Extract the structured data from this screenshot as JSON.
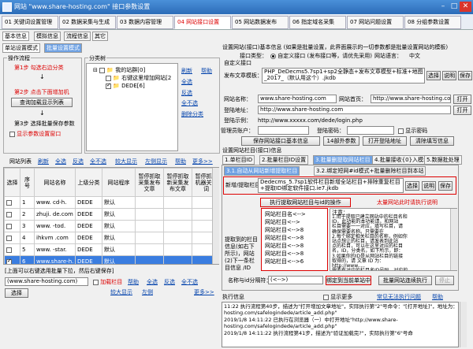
{
  "window": {
    "title": "网站 \"www.share-hosting.com\" 接口参数设置",
    "min": "–",
    "max": "□",
    "close": "✕"
  },
  "main_tabs": [
    {
      "label": "01 关键词设置管理"
    },
    {
      "label": "02 数据采集与生成"
    },
    {
      "label": "03 数据内容管理"
    },
    {
      "label": "04 网站接口设置"
    },
    {
      "label": "05 网站数据发布"
    },
    {
      "label": "06 指定域名采集"
    },
    {
      "label": "07 网站问题设置"
    },
    {
      "label": "08 分组参数设置"
    }
  ],
  "left_tabs": [
    "基本信息",
    "模拟信息",
    "流程信息",
    "其它"
  ],
  "mode_tabs": [
    "单站设置模式",
    "批量设置模式"
  ],
  "flow": {
    "group_title": "操作流程",
    "step1": "第1步 勾选右边分类",
    "step2": "第2步 点击下面增加机",
    "btn_query": "查询加载显示列表",
    "step3": "第3步 选择批量保存参数",
    "show_window": "显示参数设置窗口"
  },
  "category": {
    "title": "分类树",
    "root": "我的站群[0]",
    "child1": "右键这里增加网站[2",
    "child2": "DEDE[6]",
    "links": [
      "刷新",
      "帮助",
      "全选",
      "反选",
      "全不选",
      "删除分类"
    ]
  },
  "list": {
    "toolbar_label": "网站列表",
    "links": [
      "刷新",
      "全选",
      "反选",
      "全不选",
      "较大显示",
      "左侧显示",
      "帮助",
      "更多>>"
    ],
    "headers": [
      "选择",
      "序号",
      "网站名称",
      "上级分类",
      "网站程序",
      "暂停抓取采集发布文章",
      "暂停抓取新采集发布文章",
      "暂停抓取机器关键词"
    ],
    "rows": [
      {
        "no": "1",
        "name": "www.   cd-h.",
        "cat": "DEDE",
        "prog": "默认",
        "checked": false
      },
      {
        "no": "2",
        "name": "zhuji.  de.com",
        "cat": "DEDE",
        "prog": "默认",
        "checked": false
      },
      {
        "no": "3",
        "name": "www.   -tod.",
        "cat": "DEDE",
        "prog": "默认",
        "checked": false
      },
      {
        "no": "4",
        "name": "ihkvm   .com",
        "cat": "DEDE",
        "prog": "默认",
        "checked": false
      },
      {
        "no": "5",
        "name": "www.  -star.",
        "cat": "DEDE",
        "prog": "默认",
        "checked": false
      },
      {
        "no": "6",
        "name": "www.share-h.",
        "cat": "DEDE",
        "prog": "默认",
        "checked": true
      }
    ],
    "status": "[上面可以右键选用批量下拉，然后右键保存]",
    "site": "(www.share-hosting.com)",
    "add_cat": "加载栏目",
    "bottom_links": [
      "帮助",
      "全选",
      "反选",
      "全不选",
      "较大显示",
      "左侧",
      "更多>>"
    ],
    "select_btn": "选择"
  },
  "iface": {
    "title": "设置网站(接口)基本信息 (如果是批量设置，此界面展示的一切参数都是批量设置网站的模板)",
    "type_label": "接口类型：",
    "type_opt1": "自定义接口 (发布接口等，请优先采用)",
    "type_name_label": "网站语言：",
    "type_name_val": "中文",
    "custom_label": "自定义接口",
    "pub_tpl_label": "发布文章模板：",
    "pub_tpl_val": "PHP_DeDecms5.7sp1+sp2全静态+发布文章模型+标准+地图_2017_（默认用这个）.jkdb",
    "btn_select": "选择",
    "btn_explain": "说明",
    "btn_save": "保存",
    "site_name_label": "网站名称：",
    "site_name_val": "www.share-hosting.com",
    "home_label": "网站首页：",
    "home_val": "http://www.share-hosting.com",
    "btn_open": "打开",
    "login_label": "登陆地址：",
    "login_val": "http://www.share-hosting.com",
    "login_ex_label": "登陆示例：",
    "login_ex_val": "http://www.xxxxx.com/dede/login.php",
    "admin_label": "管理员账户：",
    "admin_pwd_label": "登陆密码：",
    "show_pwd": "显示密码",
    "btn_save_basic": "保存网站接口基本信息",
    "btn_14": "14部外参数",
    "btn_open_login": "打开登陆地址",
    "btn_clear": "清除填写信息"
  },
  "col": {
    "title": "设置网站栏目(接口)信息",
    "tabs": [
      "1.单栏目ID",
      "2.批量栏目ID设置",
      "3.批量删提取网站栏目",
      "4.批量接收{0}入模块",
      "5.数据批处理"
    ],
    "subtabs": [
      "3.1.自动从网站新增提取栏目",
      "3.2.绑定短网#id模式+批量删除栏目到本站"
    ],
    "add_label": "新增/提取栏目：",
    "add_val": "Dedecms_5.7sp1软件栏目新增全站栏目+排除重复栏目+提取ID绑定软件接口.ie7.jkdb",
    "btn_run": "执行提取网站栏目与id的操作",
    "hint": "太量网站此时请执行说明",
    "tree_lines": [
      "网站栏目名<-->",
      "网站栏目<-->",
      "网站栏目<-->8",
      "网站栏目<-->8",
      "网站栏目<-->8",
      "网站栏目<-->8",
      "网站栏目<-->6"
    ],
    "note_left": "提取到的栏目信息(如右下所示)，网站(2)下一条栏目信息 /ID",
    "note_title": "注意：",
    "note_lines": [
      "1.用于提取已建立网站中的栏目名和",
      "ID，此功能的本功能请，和网站",
      "栏目需要一一对应，填写栏目，请",
      "确保需要名称。只需要在",
      "2.每个绑定相关栏目的名称，例如你",
      "站点想让的栏目，请发表到此站",
      "点的栏目，可以在这里对应的栏目",
      "名，ID，分类名，如下所示，即：",
      "3.如果你的ID是从网站栏目的链接",
      "取得的，请 文章 ID 为：",
      "http://www.....",
      "需要有对应的栏目名ID号码，对应的"
    ],
    "idmap_label": "名称与id分隔符：",
    "idmap_val": "(<-->)",
    "btn_bind": "绑定到当前单站中",
    "btn_bind_batch": "批量网站连续执行",
    "btn_stop": "停止"
  },
  "log": {
    "title": "执行信息",
    "show_detail": "显示更多",
    "link1": "常见无法执行问题",
    "link2": "帮助",
    "lines": [
      "11:22  执行流程第40步，描述为\"打开增加文章地址\"，实际执行第\"2\"号命令：\"[打开地址]\"，地址为：\"http://www.share-",
      "hosting.com/safelogindede/article_add.php\"",
      "2019/1/8 14:11:22  已执行在浏览器（一）中打开地址\"http://www.share-",
      "hosting.com/safelogindede/article_add.php\"",
      "2019/1/8 14:11:22  执行流程第41步，描述为\"验证加载完?\"，实际执行第\"6\"号命"
    ]
  },
  "colors": {
    "accent_red": "#d00000",
    "selected_row": "#3a7de0",
    "title_blue": "#2c6cb8"
  }
}
